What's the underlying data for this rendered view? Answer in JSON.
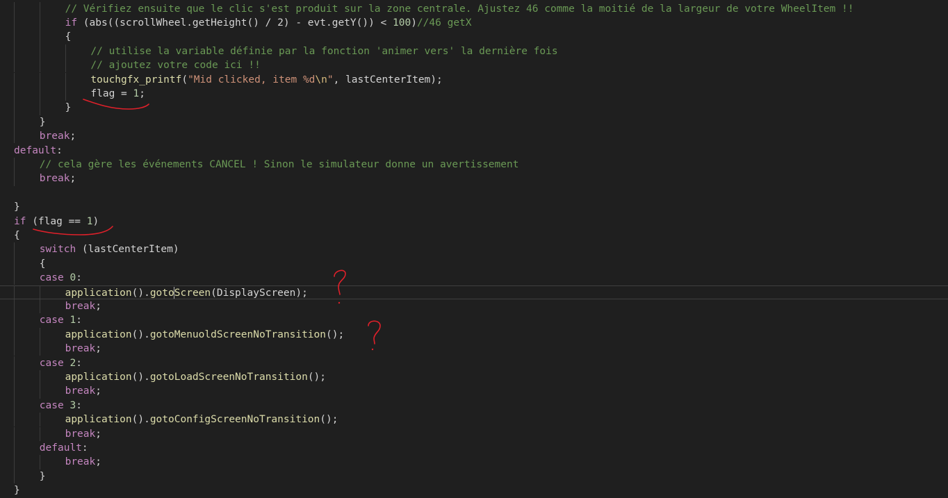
{
  "editor": {
    "colors": {
      "background": "#1f1f1f",
      "keyword": "#569cd6",
      "control": "#c586c0",
      "function": "#dcdcaa",
      "comment": "#6a9955",
      "number": "#b5cea8",
      "string": "#ce9178",
      "annotation_ink": "#e0202a"
    },
    "lines": [
      {
        "indent": 2,
        "tokens": [
          [
            "cmt",
            "// Vérifiez ensuite que le clic s'est produit sur la zone centrale. Ajustez 46 comme la moitié de la largeur de votre WheelItem !!"
          ]
        ]
      },
      {
        "indent": 2,
        "tokens": [
          [
            "ctl",
            "if"
          ],
          [
            "punc",
            " (abs((scrollWheel.getHeight() / 2) - evt.getY()) < "
          ],
          [
            "num",
            "100"
          ],
          [
            "punc",
            ")"
          ],
          [
            "cmt",
            "//46 getX"
          ]
        ]
      },
      {
        "indent": 2,
        "tokens": [
          [
            "punc",
            "{"
          ]
        ]
      },
      {
        "indent": 3,
        "tokens": [
          [
            "cmt",
            "// utilise la variable définie par la fonction 'animer vers' la dernière fois"
          ]
        ]
      },
      {
        "indent": 3,
        "tokens": [
          [
            "cmt",
            "// ajoutez votre code ici !!"
          ]
        ]
      },
      {
        "indent": 3,
        "tokens": [
          [
            "fn",
            "touchgfx_printf"
          ],
          [
            "punc",
            "("
          ],
          [
            "str",
            "\"Mid clicked, item %d"
          ],
          [
            "esc",
            "\\n"
          ],
          [
            "str",
            "\""
          ],
          [
            "punc",
            ", lastCenterItem);"
          ]
        ]
      },
      {
        "indent": 3,
        "tokens": [
          [
            "punc",
            "flag = "
          ],
          [
            "num",
            "1"
          ],
          [
            "punc",
            ";"
          ]
        ]
      },
      {
        "indent": 2,
        "tokens": [
          [
            "punc",
            "}"
          ]
        ]
      },
      {
        "indent": 1,
        "tokens": [
          [
            "punc",
            "}"
          ]
        ]
      },
      {
        "indent": 1,
        "tokens": [
          [
            "ctl",
            "break"
          ],
          [
            "punc",
            ";"
          ]
        ]
      },
      {
        "indent": 0,
        "tokens": [
          [
            "ctl",
            "default"
          ],
          [
            "punc",
            ":"
          ]
        ]
      },
      {
        "indent": 1,
        "tokens": [
          [
            "cmt",
            "// cela gère les événements CANCEL ! Sinon le simulateur donne un avertissement"
          ]
        ]
      },
      {
        "indent": 1,
        "tokens": [
          [
            "ctl",
            "break"
          ],
          [
            "punc",
            ";"
          ]
        ]
      },
      {
        "indent": 0,
        "tokens": []
      },
      {
        "indent": 0,
        "tokens": [
          [
            "punc",
            "}"
          ]
        ]
      },
      {
        "indent": 0,
        "tokens": [
          [
            "ctl",
            "if"
          ],
          [
            "punc",
            " (flag == "
          ],
          [
            "num",
            "1"
          ],
          [
            "punc",
            ")"
          ]
        ]
      },
      {
        "indent": 0,
        "tokens": [
          [
            "punc",
            "{"
          ]
        ]
      },
      {
        "indent": 1,
        "tokens": [
          [
            "ctl",
            "switch"
          ],
          [
            "punc",
            " (lastCenterItem)"
          ]
        ]
      },
      {
        "indent": 1,
        "tokens": [
          [
            "punc",
            "{"
          ]
        ]
      },
      {
        "indent": 1,
        "tokens": [
          [
            "ctl",
            "case"
          ],
          [
            "punc",
            " "
          ],
          [
            "num",
            "0"
          ],
          [
            "punc",
            ":"
          ]
        ]
      },
      {
        "indent": 2,
        "current": true,
        "tokens": [
          [
            "fn",
            "application"
          ],
          [
            "punc",
            "()."
          ],
          [
            "fn",
            "goto"
          ],
          [
            "cursor",
            ""
          ],
          [
            "fn",
            "Screen"
          ],
          [
            "punc",
            "(DisplayScreen);"
          ]
        ]
      },
      {
        "indent": 2,
        "tokens": [
          [
            "ctl",
            "break"
          ],
          [
            "punc",
            ";"
          ]
        ]
      },
      {
        "indent": 1,
        "tokens": [
          [
            "ctl",
            "case"
          ],
          [
            "punc",
            " "
          ],
          [
            "num",
            "1"
          ],
          [
            "punc",
            ":"
          ]
        ]
      },
      {
        "indent": 2,
        "tokens": [
          [
            "fn",
            "application"
          ],
          [
            "punc",
            "()."
          ],
          [
            "fn",
            "gotoMenuoldScreenNoTransition"
          ],
          [
            "punc",
            "();"
          ]
        ]
      },
      {
        "indent": 2,
        "tokens": [
          [
            "ctl",
            "break"
          ],
          [
            "punc",
            ";"
          ]
        ]
      },
      {
        "indent": 1,
        "tokens": [
          [
            "ctl",
            "case"
          ],
          [
            "punc",
            " "
          ],
          [
            "num",
            "2"
          ],
          [
            "punc",
            ":"
          ]
        ]
      },
      {
        "indent": 2,
        "tokens": [
          [
            "fn",
            "application"
          ],
          [
            "punc",
            "()."
          ],
          [
            "fn",
            "gotoLoadScreenNoTransition"
          ],
          [
            "punc",
            "();"
          ]
        ]
      },
      {
        "indent": 2,
        "tokens": [
          [
            "ctl",
            "break"
          ],
          [
            "punc",
            ";"
          ]
        ]
      },
      {
        "indent": 1,
        "tokens": [
          [
            "ctl",
            "case"
          ],
          [
            "punc",
            " "
          ],
          [
            "num",
            "3"
          ],
          [
            "punc",
            ":"
          ]
        ]
      },
      {
        "indent": 2,
        "tokens": [
          [
            "fn",
            "application"
          ],
          [
            "punc",
            "()."
          ],
          [
            "fn",
            "gotoConfigScreenNoTransition"
          ],
          [
            "punc",
            "();"
          ]
        ]
      },
      {
        "indent": 2,
        "tokens": [
          [
            "ctl",
            "break"
          ],
          [
            "punc",
            ";"
          ]
        ]
      },
      {
        "indent": 1,
        "tokens": [
          [
            "ctl",
            "default"
          ],
          [
            "punc",
            ":"
          ]
        ]
      },
      {
        "indent": 2,
        "tokens": [
          [
            "ctl",
            "break"
          ],
          [
            "punc",
            ";"
          ]
        ]
      },
      {
        "indent": 1,
        "tokens": [
          [
            "punc",
            "}"
          ]
        ]
      },
      {
        "indent": 0,
        "tokens": [
          [
            "punc",
            "}"
          ]
        ]
      }
    ]
  }
}
